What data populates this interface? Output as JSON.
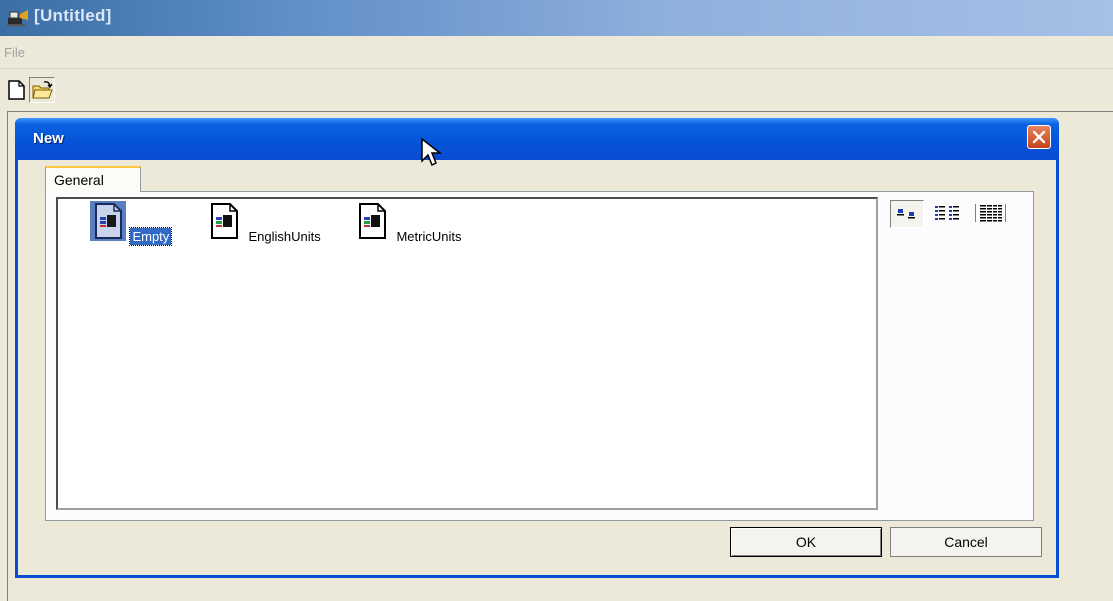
{
  "app": {
    "title": "[Untitled]",
    "icon": "app-logo-icon",
    "menu": {
      "file_label": "File"
    },
    "toolbar": {
      "new_icon": "new-document-icon",
      "open_icon": "open-folder-icon"
    }
  },
  "dialog": {
    "title": "New",
    "close_icon": "close-icon",
    "tabs": [
      {
        "label": "General",
        "selected": true
      }
    ],
    "items": [
      {
        "label": "Empty",
        "icon": "document-template-icon",
        "selected": true
      },
      {
        "label": "EnglishUnits",
        "icon": "document-template-icon",
        "selected": false
      },
      {
        "label": "MetricUnits",
        "icon": "document-template-icon",
        "selected": false
      }
    ],
    "view_modes": [
      "large-icons-view-icon",
      "list-view-icon",
      "details-view-icon"
    ],
    "buttons": {
      "ok": "OK",
      "cancel": "Cancel"
    }
  },
  "colors": {
    "dialog_title": "#0A4BD0",
    "selection": "#316AC5",
    "close": "#D4552B",
    "face": "#ECE9D8"
  }
}
